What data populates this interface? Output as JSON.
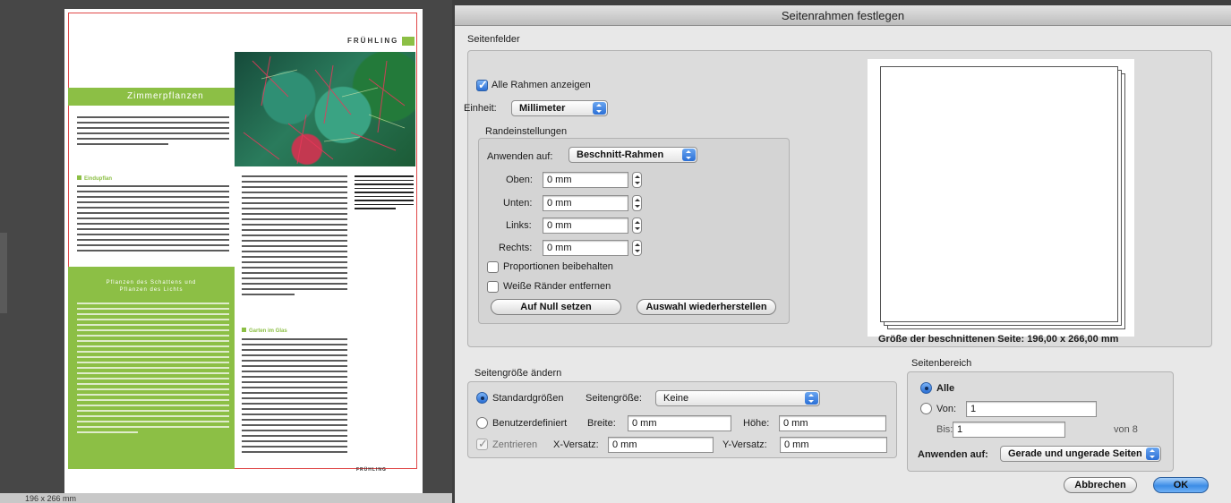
{
  "document": {
    "running_head": "FRÜHLING",
    "section_title": "Zimmerpflanzen",
    "box_title_line1": "Pflanzen des Schattens und",
    "box_title_line2": "Pflanzen des Lichts",
    "subheads": [
      "Eindupflan",
      "Garten im Glas"
    ],
    "footer": "FRÜHLING",
    "status": "196 x 266 mm"
  },
  "dialog": {
    "title": "Seitenrahmen festlegen",
    "page_fields": {
      "group_label": "Seitenfelder",
      "show_all_frames_label": "Alle Rahmen anzeigen",
      "show_all_frames_checked": true,
      "unit_label": "Einheit:",
      "unit_value": "Millimeter",
      "margins": {
        "group_label": "Randeinstellungen",
        "apply_to_label": "Anwenden auf:",
        "apply_to_value": "Beschnitt-Rahmen",
        "top_label": "Oben:",
        "top_value": "0 mm",
        "bottom_label": "Unten:",
        "bottom_value": "0 mm",
        "left_label": "Links:",
        "left_value": "0 mm",
        "right_label": "Rechts:",
        "right_value": "0 mm",
        "keep_proportions_label": "Proportionen beibehalten",
        "keep_proportions_checked": false,
        "remove_white_margins_label": "Weiße Ränder entfernen",
        "remove_white_margins_checked": false,
        "reset_button": "Auf Null setzen",
        "restore_button": "Auswahl wiederherstellen"
      },
      "preview_caption": "Größe der beschnittenen Seite: 196,00 x 266,00 mm"
    },
    "page_size": {
      "group_label": "Seitengröße ändern",
      "standard_label": "Standardgrößen",
      "standard_selected": true,
      "page_size_label": "Seitengröße:",
      "page_size_value": "Keine",
      "custom_label": "Benutzerdefiniert",
      "width_label": "Breite:",
      "width_value": "0 mm",
      "height_label": "Höhe:",
      "height_value": "0 mm",
      "center_label": "Zentrieren",
      "center_checked": true,
      "x_offset_label": "X-Versatz:",
      "x_offset_value": "0 mm",
      "y_offset_label": "Y-Versatz:",
      "y_offset_value": "0 mm"
    },
    "page_range": {
      "group_label": "Seitenbereich",
      "all_label": "Alle",
      "all_selected": true,
      "from_label": "Von:",
      "from_value": "1",
      "to_label": "Bis:",
      "to_value": "1",
      "of_text": "von 8",
      "apply_to_label": "Anwenden auf:",
      "apply_to_value": "Gerade und ungerade Seiten"
    },
    "cancel_button": "Abbrechen",
    "ok_button": "OK"
  },
  "colors": {
    "accent_green": "#8cbf45",
    "frame_red": "#e04848",
    "aqua_blue": "#3c8de6"
  }
}
